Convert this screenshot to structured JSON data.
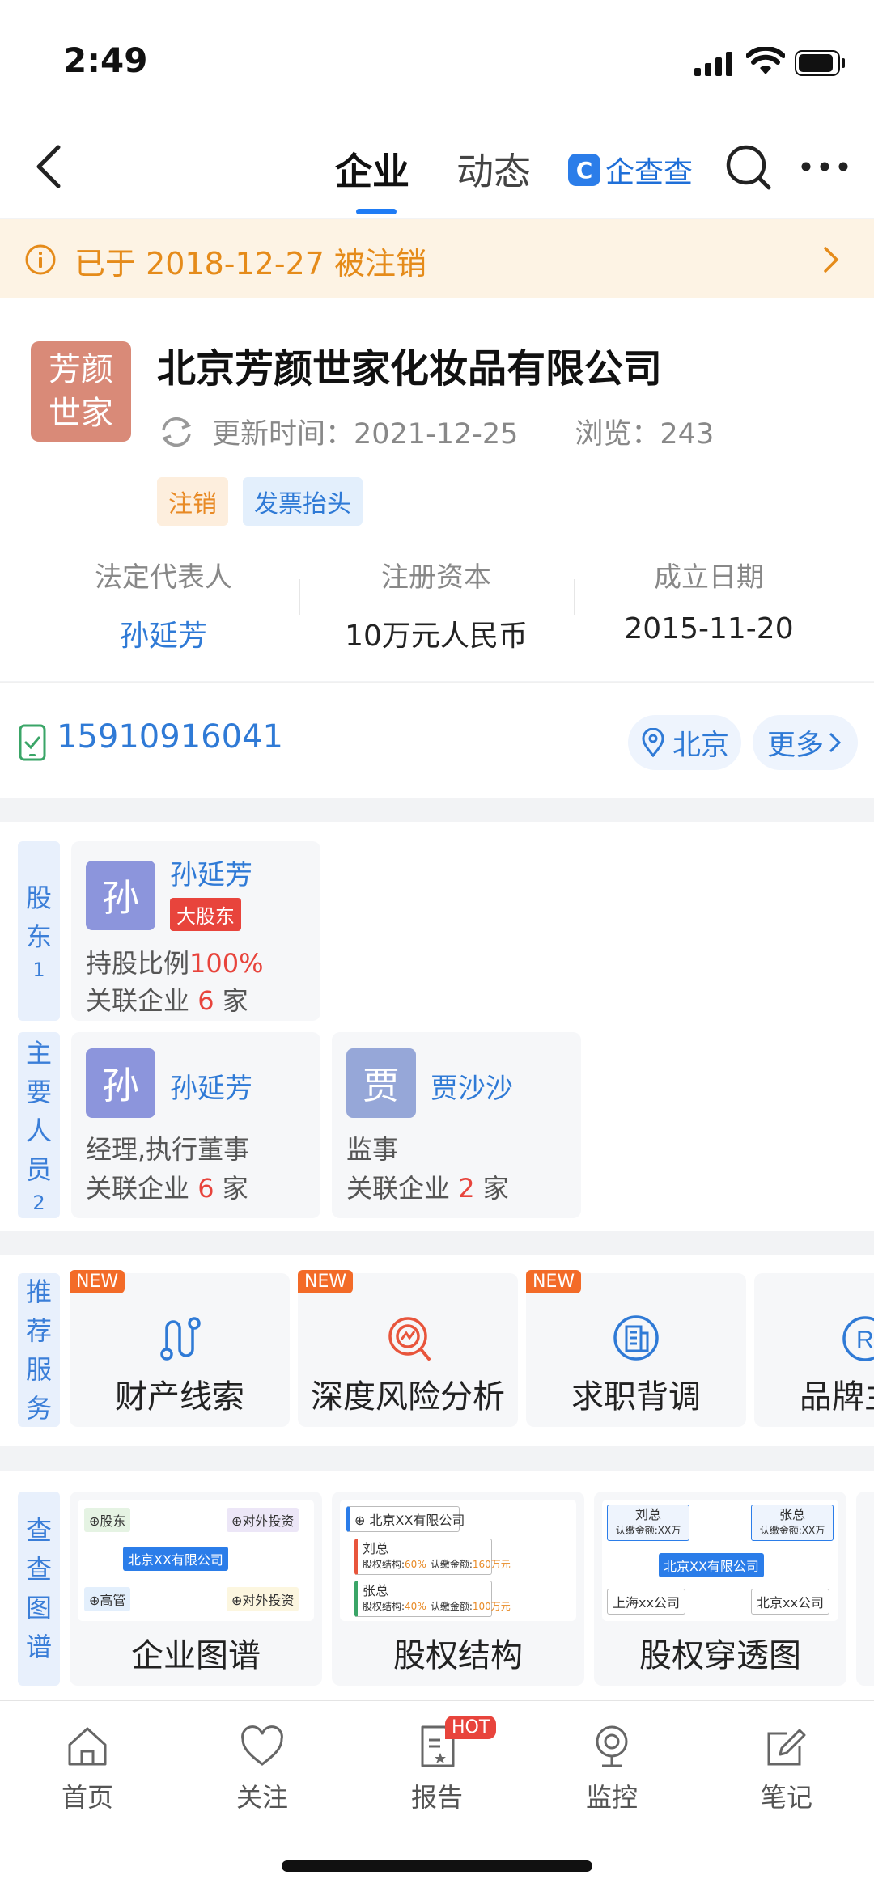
{
  "status_bar": {
    "time": "2:49"
  },
  "nav": {
    "tabs": [
      {
        "label": "企业"
      },
      {
        "label": "动态"
      }
    ],
    "brand": "企查查"
  },
  "banner": {
    "text": "已于 2018-12-27 被注销"
  },
  "company": {
    "logo_text": "芳颜世家",
    "name": "北京芳颜世家化妆品有限公司",
    "update_label": "更新时间：2021-12-25",
    "views_label": "浏览：243",
    "tags": [
      {
        "label": "注销",
        "color": "#e88a25"
      },
      {
        "label": "发票抬头",
        "color": "#2f7ad6"
      }
    ],
    "key_info": [
      {
        "label": "法定代表人",
        "value": "孙延芳"
      },
      {
        "label": "注册资本",
        "value": "10万元人民币"
      },
      {
        "label": "成立日期",
        "value": "2015-11-20"
      }
    ]
  },
  "contact": {
    "phone": "15910916041",
    "location": "北京",
    "more": "更多"
  },
  "shareholders": {
    "label": "股东",
    "count": "1",
    "items": [
      {
        "avatar": "孙",
        "name": "孙延芳",
        "badge": "大股东",
        "ratio_label": "持股比例",
        "ratio": "100%",
        "related_prefix": "关联企业",
        "related_count": "6",
        "related_suffix": "家"
      }
    ]
  },
  "personnel": {
    "label": "主要人员",
    "count": "2",
    "items": [
      {
        "avatar": "孙",
        "name": "孙延芳",
        "role": "经理,执行董事",
        "related_prefix": "关联企业",
        "related_count": "6",
        "related_suffix": "家"
      },
      {
        "avatar": "贾",
        "name": "贾沙沙",
        "role": "监事",
        "related_prefix": "关联企业",
        "related_count": "2",
        "related_suffix": "家"
      }
    ]
  },
  "services": {
    "label": "推荐服务",
    "items": [
      {
        "label": "财产线索",
        "badge": "NEW",
        "icon": "route-icon"
      },
      {
        "label": "深度风险分析",
        "badge": "NEW",
        "icon": "risk-analysis-icon"
      },
      {
        "label": "求职背调",
        "badge": "NEW",
        "icon": "building-search-icon"
      },
      {
        "label": "品牌主",
        "badge": "",
        "icon": "trademark-icon"
      }
    ]
  },
  "graphs": {
    "label": "查查图谱",
    "items": [
      {
        "label": "企业图谱",
        "thumb": {
          "center": "北京XX有限公司",
          "tl": "股东",
          "tr": "对外投资",
          "bl": "高管",
          "br": "对外投资"
        }
      },
      {
        "label": "股权结构",
        "thumb": {
          "root": "北京XX有限公司",
          "rows": [
            {
              "name": "刘总",
              "detail_prefix": "股权结构:",
              "ratio": "60%",
              "amount_prefix": "认缴金额:",
              "amount": "160万元"
            },
            {
              "name": "张总",
              "detail_prefix": "股权结构:",
              "ratio": "40%",
              "amount_prefix": "认缴金额:",
              "amount": "100万元"
            }
          ]
        }
      },
      {
        "label": "股权穿透图",
        "thumb": {
          "left_name": "刘总",
          "left_amount": "认缴金额:XX万",
          "right_name": "张总",
          "right_amount": "认缴金额:XX万",
          "center": "北京XX有限公司",
          "bottom_left": "上海xx公司",
          "bottom_right": "北京xx公司"
        }
      }
    ]
  },
  "tabbar": {
    "items": [
      {
        "label": "首页",
        "icon": "home-icon"
      },
      {
        "label": "关注",
        "icon": "heart-icon"
      },
      {
        "label": "报告",
        "icon": "report-icon",
        "badge": "HOT"
      },
      {
        "label": "监控",
        "icon": "camera-icon"
      },
      {
        "label": "笔记",
        "icon": "note-icon"
      }
    ]
  }
}
